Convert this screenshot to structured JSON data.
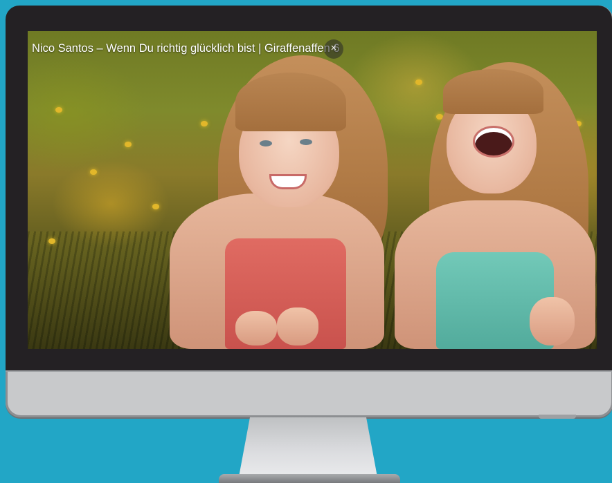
{
  "video": {
    "title": "Nico Santos – Wenn Du richtig glücklich bist | Giraffenaffen 6",
    "close_symbol": "×"
  },
  "colors": {
    "background": "#22a6c6",
    "bezel": "#242124",
    "monitor_body": "#c8c9cb"
  }
}
